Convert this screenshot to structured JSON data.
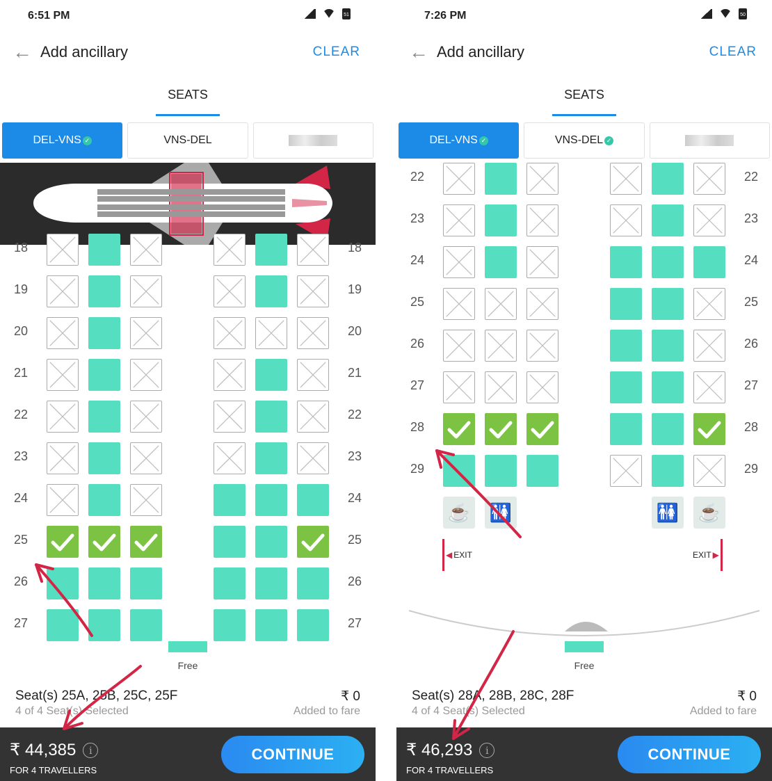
{
  "screens": [
    {
      "status_time": "6:51 PM",
      "battery": "51",
      "header": {
        "title": "Add ancillary",
        "clear_label": "CLEAR"
      },
      "tab_label": "SEATS",
      "segments": [
        {
          "label": "DEL-VNS",
          "active": true,
          "checked": true
        },
        {
          "label": "VNS-DEL",
          "active": false,
          "checked": false
        },
        {
          "label": "",
          "active": false,
          "checked": false,
          "blurred": true
        }
      ],
      "show_plane_overview": true,
      "seat_rows": [
        {
          "num": "18",
          "seats": [
            "blocked",
            "available",
            "blocked",
            "blocked",
            "available",
            "blocked"
          ]
        },
        {
          "num": "19",
          "seats": [
            "blocked",
            "available",
            "blocked",
            "blocked",
            "available",
            "blocked"
          ]
        },
        {
          "num": "20",
          "seats": [
            "blocked",
            "available",
            "blocked",
            "blocked",
            "blocked",
            "blocked"
          ]
        },
        {
          "num": "21",
          "seats": [
            "blocked",
            "available",
            "blocked",
            "blocked",
            "available",
            "blocked"
          ]
        },
        {
          "num": "22",
          "seats": [
            "blocked",
            "available",
            "blocked",
            "blocked",
            "available",
            "blocked"
          ]
        },
        {
          "num": "23",
          "seats": [
            "blocked",
            "available",
            "blocked",
            "blocked",
            "available",
            "blocked"
          ]
        },
        {
          "num": "24",
          "seats": [
            "blocked",
            "available",
            "blocked",
            "available",
            "available",
            "available"
          ]
        },
        {
          "num": "25",
          "seats": [
            "selected",
            "selected",
            "selected",
            "available",
            "available",
            "selected"
          ]
        },
        {
          "num": "26",
          "seats": [
            "available",
            "available",
            "available",
            "available",
            "available",
            "available"
          ]
        },
        {
          "num": "27",
          "seats": [
            "available",
            "available",
            "available",
            "available",
            "available",
            "available"
          ]
        }
      ],
      "legend_free_label": "Free",
      "summary": {
        "seats_text": "Seat(s) 25A, 25B, 25C, 25F",
        "count_text": "4 of 4 Seat(s) Selected",
        "price_text": "₹ 0",
        "added_text": "Added to fare"
      },
      "footer": {
        "total": "₹ 44,385",
        "travellers": "FOR 4 TRAVELLERS",
        "continue_label": "CONTINUE"
      },
      "icons": {
        "back": "arrow-left-icon",
        "info": "info-icon"
      }
    },
    {
      "status_time": "7:26 PM",
      "battery": "50",
      "header": {
        "title": "Add ancillary",
        "clear_label": "CLEAR"
      },
      "tab_label": "SEATS",
      "segments": [
        {
          "label": "DEL-VNS",
          "active": true,
          "checked": true
        },
        {
          "label": "VNS-DEL",
          "active": false,
          "checked": true
        },
        {
          "label": "",
          "active": false,
          "checked": false,
          "blurred": true
        }
      ],
      "show_plane_overview": false,
      "seat_rows": [
        {
          "num": "22",
          "seats": [
            "blocked",
            "available",
            "blocked",
            "blocked",
            "available",
            "blocked"
          ]
        },
        {
          "num": "23",
          "seats": [
            "blocked",
            "available",
            "blocked",
            "blocked",
            "available",
            "blocked"
          ]
        },
        {
          "num": "24",
          "seats": [
            "blocked",
            "available",
            "blocked",
            "available",
            "available",
            "available"
          ]
        },
        {
          "num": "25",
          "seats": [
            "blocked",
            "blocked",
            "blocked",
            "available",
            "available",
            "blocked"
          ]
        },
        {
          "num": "26",
          "seats": [
            "blocked",
            "blocked",
            "blocked",
            "available",
            "available",
            "blocked"
          ]
        },
        {
          "num": "27",
          "seats": [
            "blocked",
            "blocked",
            "blocked",
            "available",
            "available",
            "blocked"
          ]
        },
        {
          "num": "28",
          "seats": [
            "selected",
            "selected",
            "selected",
            "available",
            "available",
            "selected"
          ]
        },
        {
          "num": "29",
          "seats": [
            "available",
            "available",
            "available",
            "blocked",
            "available",
            "blocked"
          ]
        }
      ],
      "exit_label": "EXIT",
      "legend_free_label": "Free",
      "summary": {
        "seats_text": "Seat(s) 28A, 28B, 28C, 28F",
        "count_text": "4 of 4 Seat(s) Selected",
        "price_text": "₹ 0",
        "added_text": "Added to fare"
      },
      "footer": {
        "total": "₹ 46,293",
        "travellers": "FOR 4 TRAVELLERS",
        "continue_label": "CONTINUE"
      },
      "icons": {
        "back": "arrow-left-icon",
        "info": "info-icon"
      }
    }
  ],
  "colors": {
    "accent": "#1c8be8",
    "seat_available": "#55dfc0",
    "seat_selected": "#7cc243",
    "annotation_arrow": "#d32647",
    "footer_bg": "#333333"
  }
}
